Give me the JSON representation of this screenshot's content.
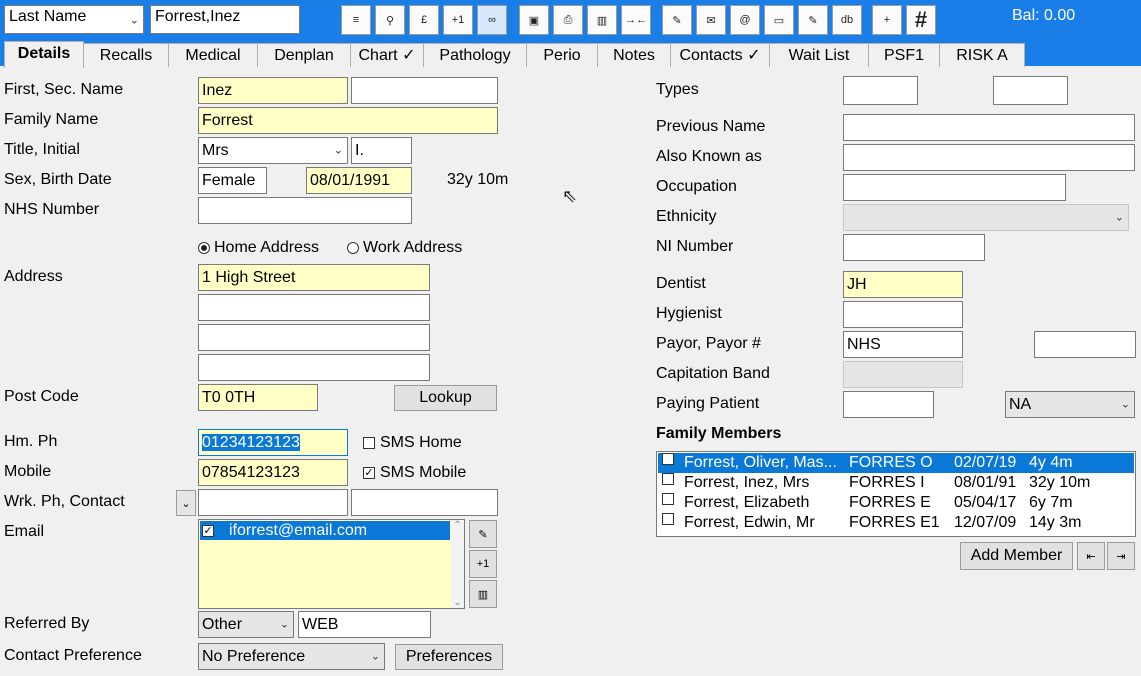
{
  "toolbar": {
    "search_type": "Last Name",
    "search_value": "Forrest,Inez",
    "balance": "Bal: 0.00",
    "buttons": [
      {
        "icon": "list-icon",
        "glyph": "≡"
      },
      {
        "icon": "search-icon",
        "glyph": "🔍"
      },
      {
        "icon": "pound-icon",
        "glyph": "£"
      },
      {
        "icon": "plus-one-icon",
        "glyph": "+1"
      },
      {
        "icon": "link-icon",
        "glyph": "∞"
      },
      {
        "icon": "save-icon",
        "glyph": "💾"
      },
      {
        "icon": "print-icon",
        "glyph": "⎙"
      },
      {
        "icon": "delete-icon",
        "glyph": "🗑"
      },
      {
        "icon": "merge-icon",
        "glyph": "→←"
      },
      {
        "icon": "tools-icon",
        "glyph": "✎"
      },
      {
        "icon": "letter-icon",
        "glyph": "✉"
      },
      {
        "icon": "email-icon",
        "glyph": "@"
      },
      {
        "icon": "card-icon",
        "glyph": "▭"
      },
      {
        "icon": "note-icon",
        "glyph": "✎"
      },
      {
        "icon": "database-icon",
        "glyph": "db"
      },
      {
        "icon": "add-page-icon",
        "glyph": "+"
      },
      {
        "icon": "grid-icon",
        "glyph": "#"
      }
    ]
  },
  "tabs": [
    {
      "label": "Details"
    },
    {
      "label": "Recalls"
    },
    {
      "label": "Medical"
    },
    {
      "label": "Denplan"
    },
    {
      "label": "Chart ✓"
    },
    {
      "label": "Pathology"
    },
    {
      "label": "Perio"
    },
    {
      "label": "Notes"
    },
    {
      "label": "Contacts ✓"
    },
    {
      "label": "Wait List"
    },
    {
      "label": "PSF1"
    },
    {
      "label": "RISK A"
    }
  ],
  "left": {
    "first_sec_name_label": "First, Sec. Name",
    "first_name": "Inez",
    "second_name": "",
    "family_name_label": "Family Name",
    "family_name": "Forrest",
    "title_initial_label": "Title, Initial",
    "title": "Mrs",
    "initial": "I.",
    "sex_birth_label": "Sex, Birth Date",
    "sex": "Female",
    "birth_date": "08/01/1991",
    "age": "32y 10m",
    "nhs_label": "NHS Number",
    "nhs_number": "",
    "home_address_label": "Home Address",
    "work_address_label": "Work Address",
    "address_label": "Address",
    "address_lines": [
      "1 High Street",
      "",
      "",
      ""
    ],
    "post_code_label": "Post Code",
    "post_code": "T0 0TH",
    "lookup_label": "Lookup",
    "hm_ph_label": "Hm. Ph",
    "hm_ph": "01234123123",
    "sms_home_label": "SMS Home",
    "mobile_label": "Mobile",
    "mobile": "07854123123",
    "sms_mobile_label": "SMS Mobile",
    "wrk_ph_label": "Wrk. Ph, Contact",
    "wrk_ph": "",
    "contact": "",
    "email_label": "Email",
    "email": "iforrest@email.com",
    "referred_by_label": "Referred By",
    "referred_by": "Other",
    "referred_detail": "WEB",
    "contact_pref_label": "Contact Preference",
    "contact_pref": "No Preference",
    "preferences_label": "Preferences"
  },
  "right": {
    "types_label": "Types",
    "previous_name_label": "Previous Name",
    "aka_label": "Also Known as",
    "occupation_label": "Occupation",
    "ethnicity_label": "Ethnicity",
    "ni_label": "NI Number",
    "dentist_label": "Dentist",
    "dentist": "JH",
    "hygienist_label": "Hygienist",
    "payor_label": "Payor, Payor #",
    "payor": "NHS",
    "capitation_label": "Capitation Band",
    "paying_label": "Paying Patient",
    "paying_select": "NA",
    "family_label": "Family Members",
    "family": [
      {
        "name": "Forrest, Oliver, Mas...",
        "code": "FORRES O",
        "dob": "02/07/19",
        "age": "4y 4m"
      },
      {
        "name": "Forrest, Inez, Mrs",
        "code": "FORRES I",
        "dob": "08/01/91",
        "age": "32y 10m"
      },
      {
        "name": "Forrest, Elizabeth",
        "code": "FORRES E",
        "dob": "05/04/17",
        "age": "6y 7m"
      },
      {
        "name": "Forrest, Edwin, Mr",
        "code": "FORRES E1",
        "dob": "12/07/09",
        "age": "14y 3m"
      }
    ],
    "add_member_label": "Add Member"
  }
}
